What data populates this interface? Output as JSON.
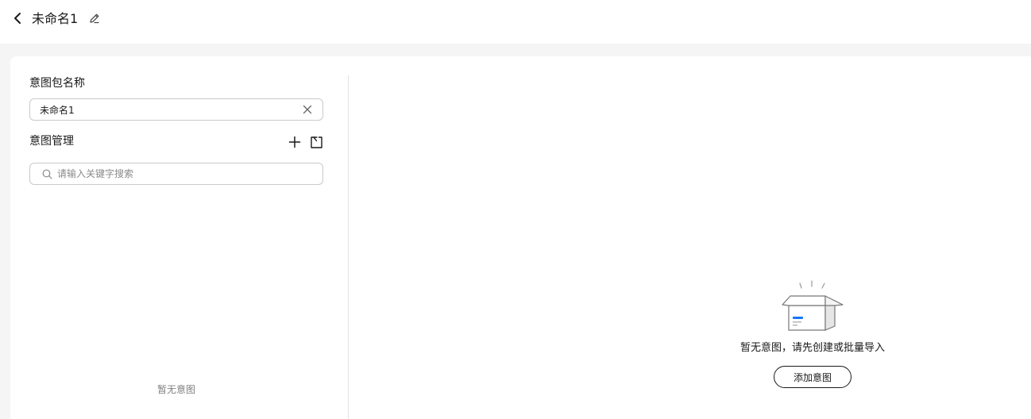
{
  "header": {
    "title": "未命名1",
    "back_icon": "chevron-left-icon",
    "edit_icon": "pencil-icon"
  },
  "form": {
    "name_label": "意图包名称",
    "name_value": "未命名1",
    "clear_icon": "close-icon"
  },
  "intent_management": {
    "label": "意图管理",
    "add_icon": "plus-icon",
    "import_icon": "import-icon",
    "search_placeholder": "请输入关键字搜索",
    "search_icon": "search-icon",
    "empty_text": "暂无意图"
  },
  "main": {
    "empty_text": "暂无意图，请先创建或批量导入",
    "add_button_label": "添加意图",
    "illustration_icon": "empty-box-icon"
  },
  "colors": {
    "background": "#f5f5f5",
    "card": "#ffffff",
    "accent": "#1476ff",
    "border": "#c9c9c9"
  }
}
